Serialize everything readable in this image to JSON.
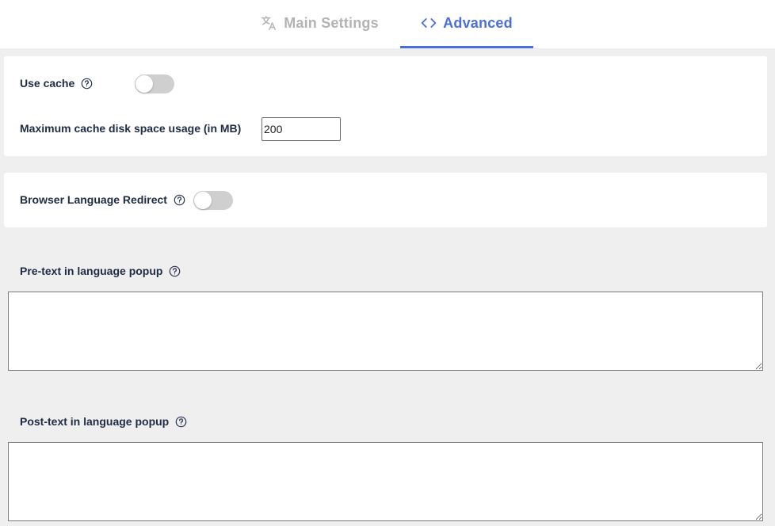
{
  "tabs": {
    "main_settings": {
      "label": "Main Settings",
      "icon": "translate-icon",
      "active": false
    },
    "advanced": {
      "label": "Advanced",
      "icon": "code-icon",
      "active": true
    }
  },
  "colors": {
    "accent": "#4a6ee0",
    "inactive_tab": "#b3b3b3",
    "label_text": "#1f2a44",
    "background": "#efefef",
    "toggle_off": "#cfcfcf"
  },
  "cache": {
    "use_cache_label": "Use cache",
    "use_cache_enabled": false,
    "max_disk_label": "Maximum cache disk space usage (in MB)",
    "max_disk_value": "200"
  },
  "redirect": {
    "label": "Browser Language Redirect",
    "enabled": false
  },
  "popup": {
    "pre_text_label": "Pre-text in language popup",
    "pre_text_value": "",
    "post_text_label": "Post-text in language popup",
    "post_text_value": ""
  }
}
